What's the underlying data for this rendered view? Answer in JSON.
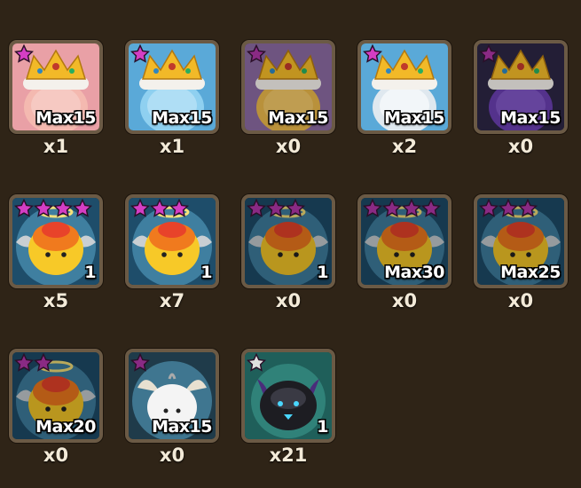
{
  "colors": {
    "background": "#2f2417",
    "star_purple": "#c239b3",
    "star_silver": "#d8d8d8",
    "frame": "#6b5a45"
  },
  "items": [
    {
      "theme": "king-pink",
      "stars": 1,
      "star_color": "purple",
      "level": "Max15",
      "count": "x1"
    },
    {
      "theme": "king-blue",
      "stars": 1,
      "star_color": "purple",
      "level": "Max15",
      "count": "x1"
    },
    {
      "theme": "king-yellow",
      "stars": 1,
      "star_color": "dark-purple",
      "level": "Max15",
      "count": "x0"
    },
    {
      "theme": "king-white",
      "stars": 1,
      "star_color": "purple",
      "level": "Max15",
      "count": "x2"
    },
    {
      "theme": "king-dark",
      "stars": 1,
      "star_color": "dark-purple",
      "level": "Max15",
      "count": "x0"
    },
    {
      "theme": "angel-4",
      "stars": 4,
      "star_color": "purple",
      "level": "1",
      "count": "x5"
    },
    {
      "theme": "angel-3",
      "stars": 3,
      "star_color": "purple",
      "level": "1",
      "count": "x7"
    },
    {
      "theme": "angel-3-dim",
      "stars": 3,
      "star_color": "dark-purple",
      "level": "1",
      "count": "x0"
    },
    {
      "theme": "angel-4-dim",
      "stars": 4,
      "star_color": "dark-purple",
      "level": "Max30",
      "count": "x0"
    },
    {
      "theme": "angel-3-dim",
      "stars": 3,
      "star_color": "dark-purple",
      "level": "Max25",
      "count": "x0"
    },
    {
      "theme": "angel-2-dim",
      "stars": 2,
      "star_color": "dark-purple",
      "level": "Max20",
      "count": "x0"
    },
    {
      "theme": "angel-white",
      "stars": 1,
      "star_color": "dark-purple",
      "level": "Max15",
      "count": "x0"
    },
    {
      "theme": "devil-dark",
      "stars": 1,
      "star_color": "silver",
      "level": "1",
      "count": "x21"
    }
  ]
}
